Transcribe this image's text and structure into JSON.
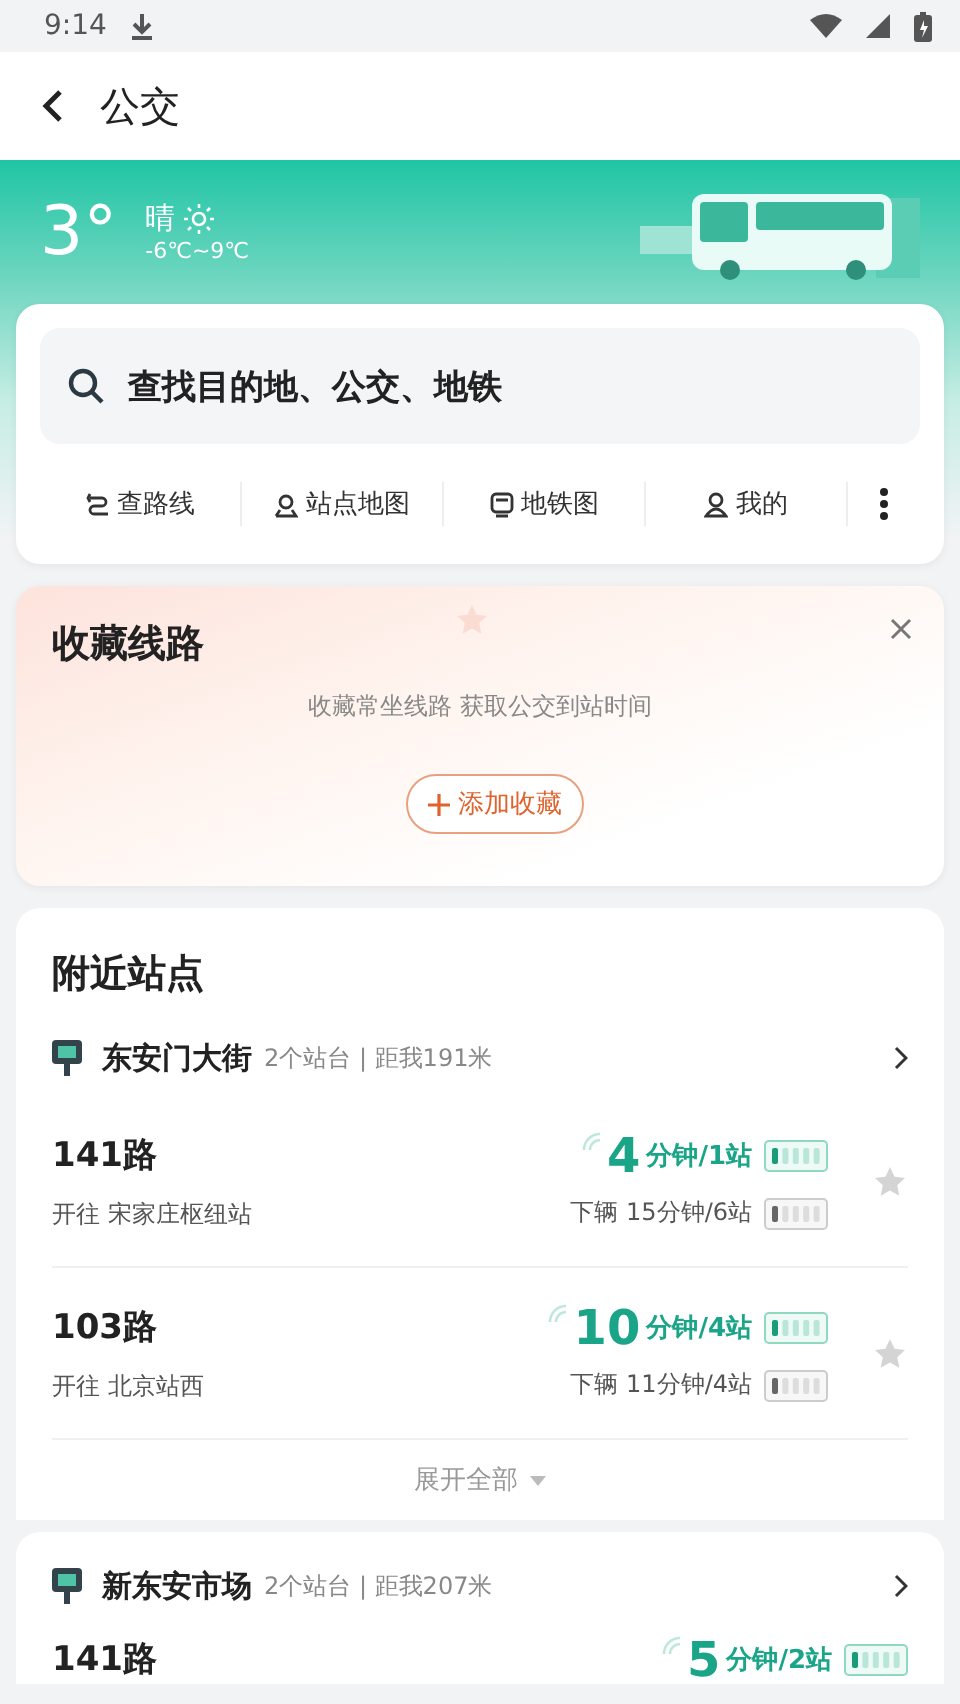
{
  "status_bar": {
    "time": "9:14"
  },
  "header": {
    "title": "公交"
  },
  "weather": {
    "temperature": "3°",
    "condition": "晴",
    "range": "-6℃~9℃"
  },
  "search": {
    "placeholder": "查找目的地、公交、地铁"
  },
  "shortcuts": [
    {
      "kind": "route",
      "label": "查路线"
    },
    {
      "kind": "stop-map",
      "label": "站点地图"
    },
    {
      "kind": "metro",
      "label": "地铁图"
    },
    {
      "kind": "mine",
      "label": "我的"
    }
  ],
  "favorites": {
    "title": "收藏线路",
    "hint": "收藏常坐线路 获取公交到站时间",
    "add_button": "添加收藏"
  },
  "nearby": {
    "title": "附近站点",
    "expand": "展开全部",
    "stations": [
      {
        "name": "东安门大街",
        "info": "2个站台 | 距我191米",
        "routes": [
          {
            "route": "141路",
            "direction": "开往 宋家庄枢纽站",
            "eta_minutes": "4",
            "eta_unit": "分钟/1站",
            "next": "下辆 15分钟/6站",
            "favorited": false
          },
          {
            "route": "103路",
            "direction": "开往 北京站西",
            "eta_minutes": "10",
            "eta_unit": "分钟/4站",
            "next": "下辆 11分钟/4站",
            "favorited": false
          }
        ]
      },
      {
        "name": "新东安市场",
        "info": "2个站台 | 距我207米",
        "routes": [
          {
            "route": "141路",
            "eta_minutes": "5",
            "eta_unit": "分钟/2站"
          }
        ]
      }
    ]
  }
}
